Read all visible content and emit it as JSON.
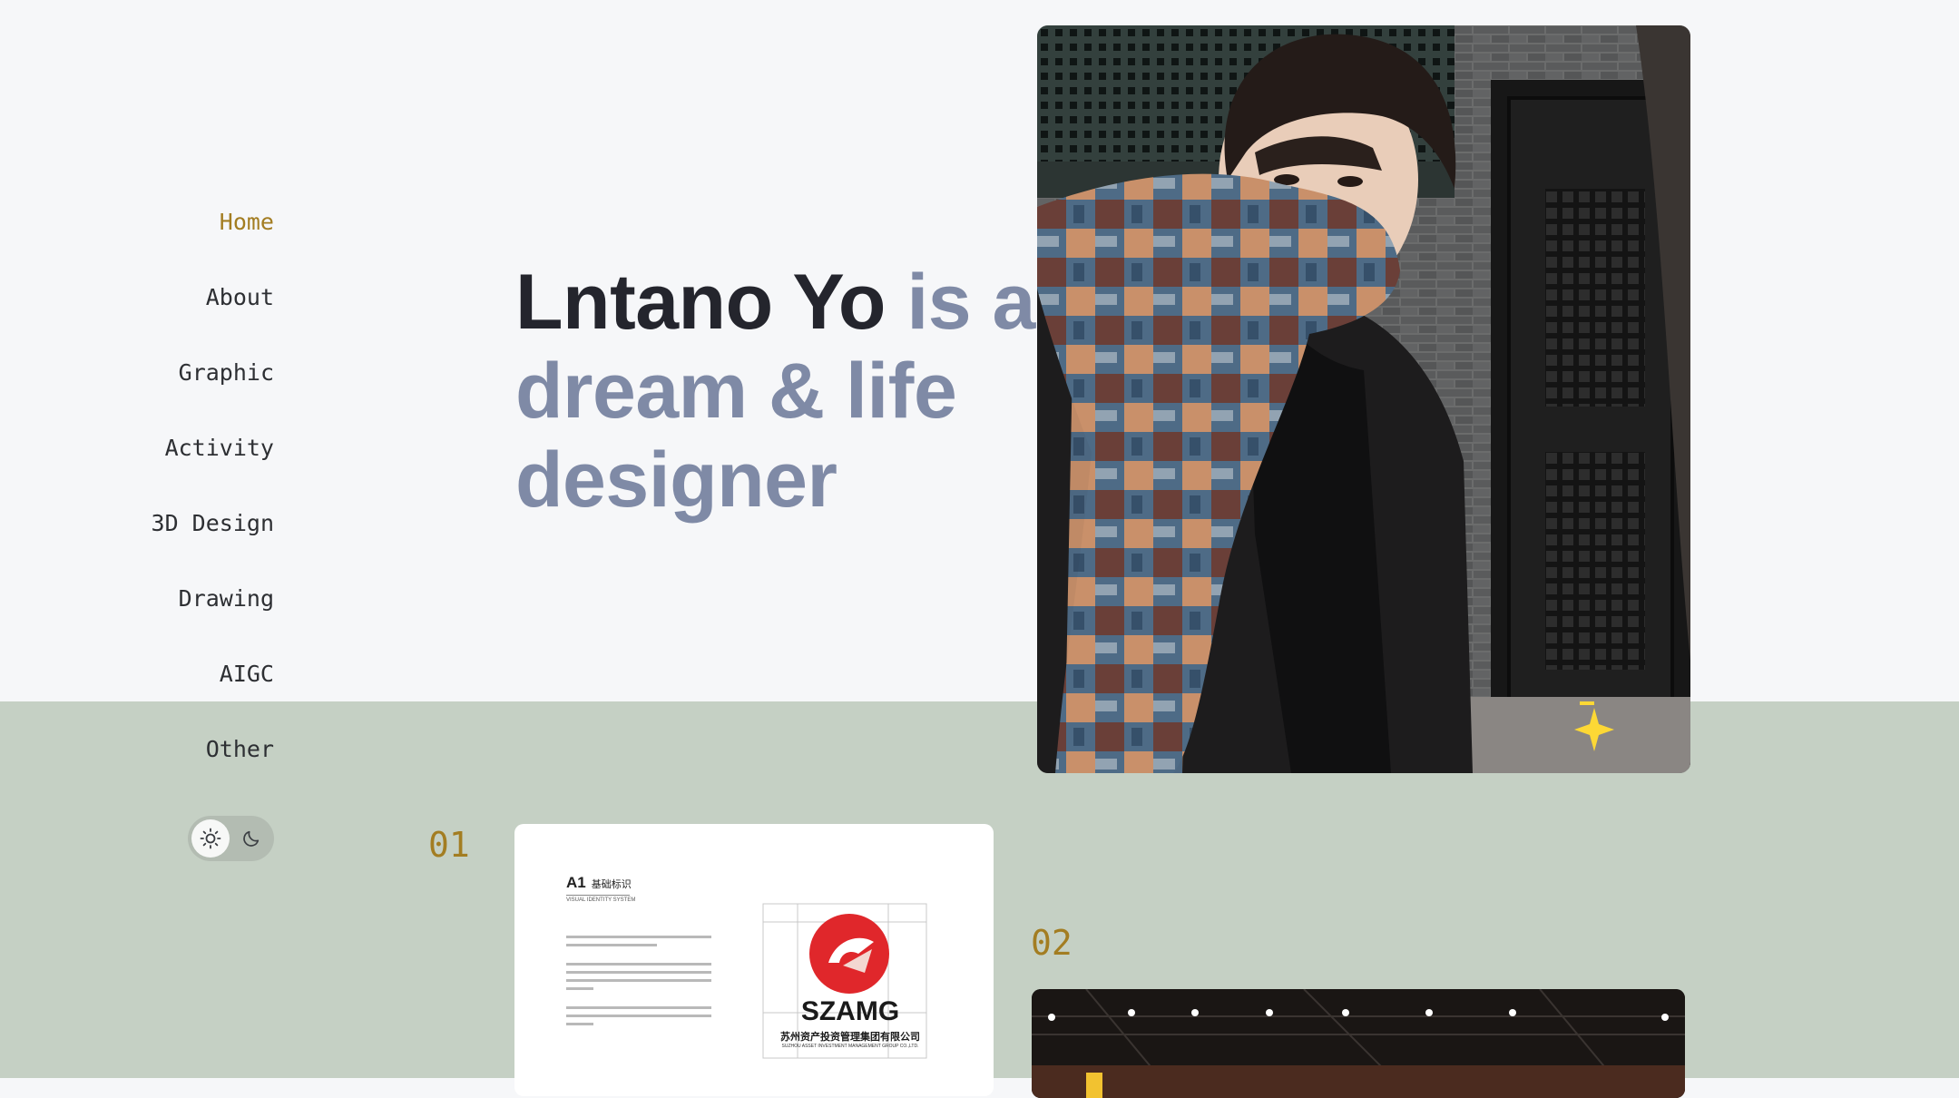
{
  "nav": {
    "items": [
      {
        "label": "Home",
        "active": true
      },
      {
        "label": "About",
        "active": false
      },
      {
        "label": "Graphic",
        "active": false
      },
      {
        "label": "Activity",
        "active": false
      },
      {
        "label": "3D Design",
        "active": false
      },
      {
        "label": "Drawing",
        "active": false
      },
      {
        "label": "AIGC",
        "active": false
      },
      {
        "label": "Other",
        "active": false
      }
    ]
  },
  "theme_toggle": {
    "light_icon": "sun-icon",
    "dark_icon": "moon-icon",
    "selected": "light"
  },
  "hero": {
    "name": "Lntano Yo",
    "tagline": "is a dream & life designer"
  },
  "projects": [
    {
      "number": "01",
      "card": {
        "section_code": "A1",
        "section_title": "基础标识",
        "section_subtitle": "VISUAL IDENTITY SYSTEM",
        "logo_text": "SZAMG",
        "company_cn": "苏州资产投资管理集团有限公司",
        "company_en": "SUZHOU ASSET INVESTMENT MANAGEMENT GROUP CO.,LTD."
      }
    },
    {
      "number": "02"
    }
  ],
  "colors": {
    "accent": "#a37d22",
    "name_text": "#24252d",
    "tagline_text": "#7f8aa6",
    "top_background": "#f6f7f9",
    "bottom_background": "#c5d0c4",
    "logo_red": "#e0272b",
    "sparkle": "#fdd835"
  }
}
